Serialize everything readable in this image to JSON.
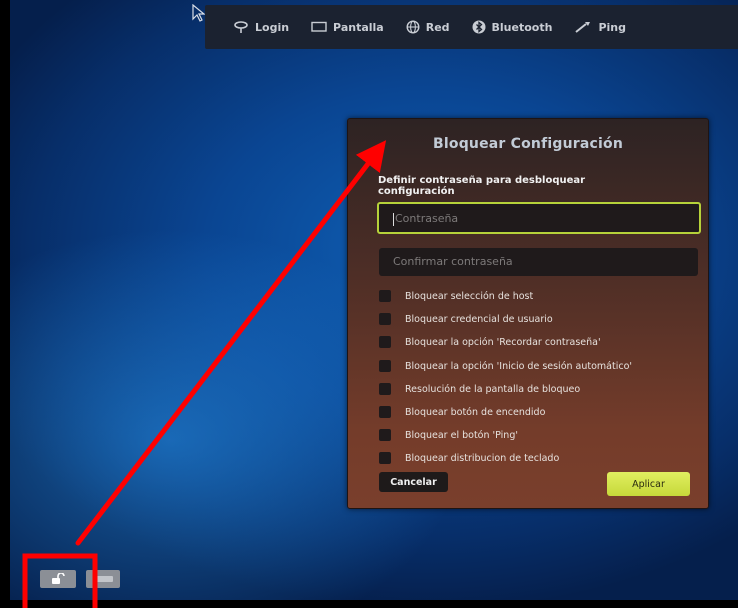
{
  "topbar": {
    "items": [
      {
        "label": "Login",
        "icon": "login-icon"
      },
      {
        "label": "Pantalla",
        "icon": "monitor-icon"
      },
      {
        "label": "Red",
        "icon": "globe-icon"
      },
      {
        "label": "Bluetooth",
        "icon": "bluetooth-icon"
      },
      {
        "label": "Ping",
        "icon": "wrench-icon"
      }
    ]
  },
  "dialog": {
    "title": "Bloquear Configuración",
    "subtitle": "Definir contraseña para desbloquear configuración",
    "password_placeholder": "Contraseña",
    "confirm_placeholder": "Confirmar contraseña",
    "options": [
      "Bloquear selección de host",
      "Bloquear credencial de usuario",
      "Bloquear la opción 'Recordar contraseña'",
      "Bloquear la opción 'Inicio de sesión automático'",
      "Resolución de la pantalla de bloqueo",
      "Bloquear botón de encendido",
      "Bloquear el botón 'Ping'",
      "Bloquear distribucion de teclado"
    ],
    "cancel_label": "Cancelar",
    "apply_label": "Aplicar"
  },
  "colors": {
    "accent_green": "#c6d93a",
    "annotation_red": "#ff0000",
    "desktop_blue": "#0a4592",
    "dialog_brown": "#743c2a"
  }
}
